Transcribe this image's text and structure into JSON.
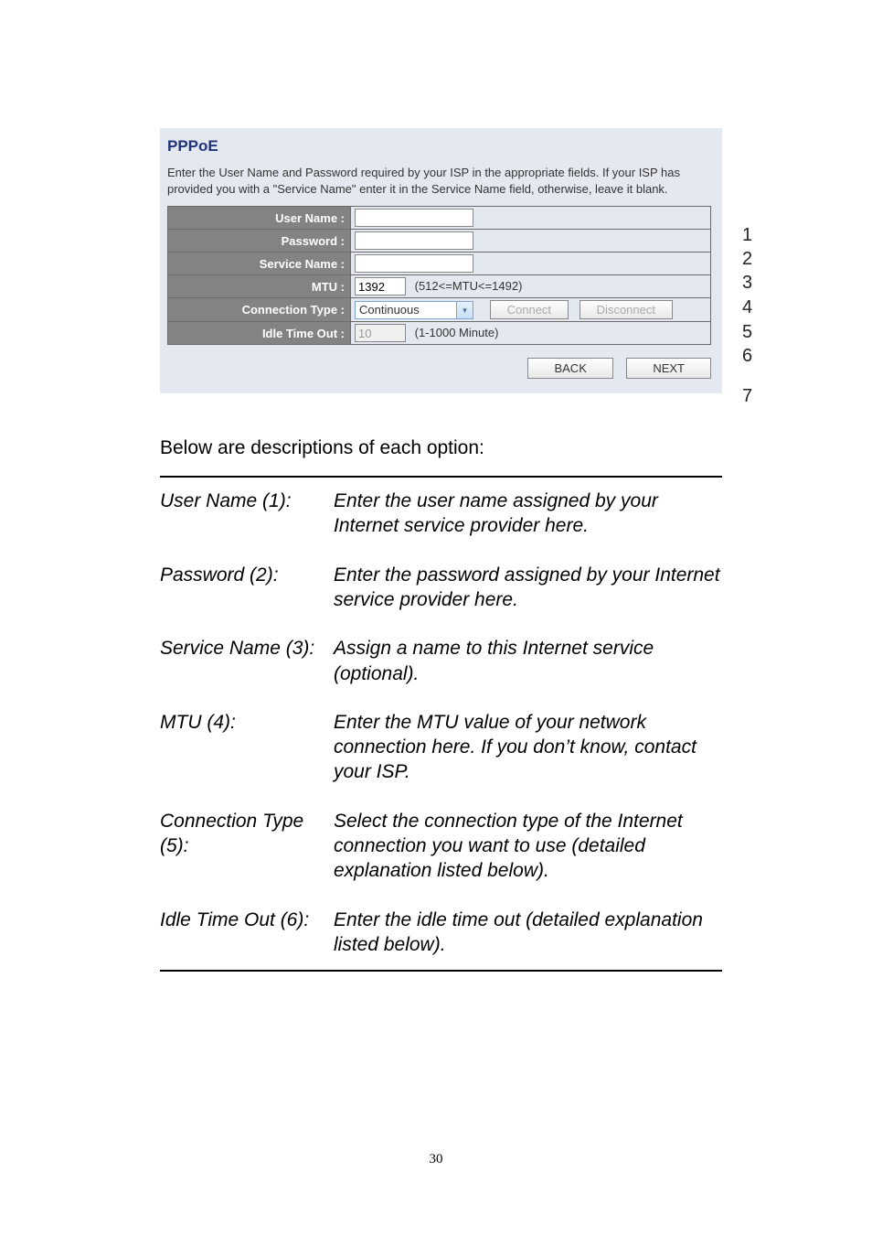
{
  "screenshot": {
    "title": "PPPoE",
    "description": "Enter the User Name and Password required by your ISP in the appropriate fields. If your ISP has provided you with a \"Service Name\" enter it in the Service Name field, otherwise, leave it blank.",
    "rows": {
      "username_label": "User Name :",
      "username_value": "",
      "password_label": "Password :",
      "password_value": "",
      "servicename_label": "Service Name :",
      "servicename_value": "",
      "mtu_label": "MTU :",
      "mtu_value": "1392",
      "mtu_hint": "(512<=MTU<=1492)",
      "conntype_label": "Connection Type :",
      "conntype_value": "Continuous",
      "connect_btn": "Connect",
      "disconnect_btn": "Disconnect",
      "idle_label": "Idle Time Out :",
      "idle_value": "10",
      "idle_hint": "(1-1000 Minute)"
    },
    "buttons": {
      "back": "BACK",
      "next": "NEXT"
    },
    "annot": {
      "n1": "1",
      "n2": "2",
      "n3": "3",
      "n4": "4",
      "n5": "5",
      "n6": "6",
      "n7": "7"
    }
  },
  "below_intro": "Below are descriptions of each option:",
  "descriptions": [
    {
      "label": "User Name (1):",
      "value": "Enter the user name assigned by your Internet service provider here."
    },
    {
      "label": "Password (2):",
      "value": "Enter the password assigned by your Internet service provider here."
    },
    {
      "label": "Service Name (3):",
      "value": "Assign a name to this Internet service (optional)."
    },
    {
      "label": "MTU (4):",
      "value": "Enter the MTU value of your network connection here. If you don’t know, contact your ISP."
    },
    {
      "label": "Connection Type (5):",
      "value": "Select the connection type of the Internet connection you want to use (detailed explanation listed below)."
    },
    {
      "label": "Idle Time Out (6):",
      "value": "Enter the idle time out (detailed explanation listed below)."
    }
  ],
  "page_number": "30"
}
